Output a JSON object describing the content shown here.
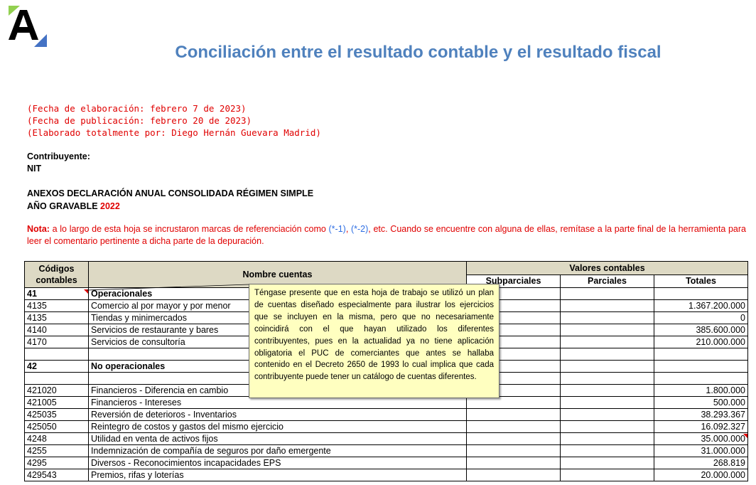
{
  "header": {
    "title": "Conciliación entre el resultado contable y el resultado fiscal"
  },
  "info": {
    "dates": [
      "(Fecha de elaboración: febrero 7 de 2023)",
      "(Fecha de publicación: febrero 20 de 2023)",
      "(Elaborado totalmente por: Diego Hernán Guevara Madrid)"
    ],
    "contribuyente": "Contribuyente:",
    "nit": "NIT",
    "anexos": "ANEXOS DECLARACIÓN ANUAL CONSOLIDADA RÉGIMEN SIMPLE",
    "ano_label": "AÑO GRAVABLE",
    "ano_value": "2022"
  },
  "nota": {
    "label": "Nota:",
    "text1": " a lo largo de esta hoja se incrustaron marcas de referenciación como ",
    "ref1": "(*-1)",
    "sep": ", ",
    "ref2": "(*-2)",
    "text2": ", etc. Cuando se encuentre con alguna de ellas, remítase a la parte final de la herramienta para leer el comentario pertinente a dicha parte de la depuración."
  },
  "table": {
    "col_codigos": "Códigos contables",
    "col_nombre": "Nombre cuentas",
    "col_valores": "Valores contables",
    "col_subparciales": "Subparciales",
    "col_parciales": "Parciales",
    "col_totales": "Totales",
    "rows": [
      {
        "code": "41",
        "name": "Operacionales",
        "total": "",
        "bold": true
      },
      {
        "code": "4135",
        "name": "Comercio al por mayor y por menor",
        "total": "1.367.200.000"
      },
      {
        "code": "4135",
        "name": "Tiendas y minimercados",
        "total": "0"
      },
      {
        "code": "4140",
        "name": "Servicios de restaurante y bares",
        "total": "385.600.000"
      },
      {
        "code": "4170",
        "name": "Servicios de consultoría",
        "total": "210.000.000"
      },
      {
        "code": "",
        "name": "",
        "total": ""
      },
      {
        "code": "42",
        "name": "No operacionales",
        "total": "",
        "bold": true
      },
      {
        "code": "",
        "name": "",
        "total": ""
      },
      {
        "code": "421020",
        "name": "Financieros - Diferencia en cambio",
        "total": "1.800.000"
      },
      {
        "code": "421005",
        "name": "Financieros - Intereses",
        "total": "500.000"
      },
      {
        "code": "425035",
        "name": "Reversión de deterioros - Inventarios",
        "total": "38.293.367"
      },
      {
        "code": "425050",
        "name": "Reintegro de costos y gastos del mismo ejercicio",
        "total": "16.092.327"
      },
      {
        "code": "4248",
        "name": "Utilidad en venta de activos fijos",
        "total": "35.000.000"
      },
      {
        "code": "4255",
        "name": "Indemnización de compañía de seguros por daño emergente",
        "total": "31.000.000"
      },
      {
        "code": "4295",
        "name": "Diversos - Reconocimientos incapacidades EPS",
        "total": "268.819"
      },
      {
        "code": "429543",
        "name": "Premios, rifas y loterías",
        "total": "20.000.000"
      }
    ]
  },
  "comment": {
    "text": "Téngase presente que en esta hoja de trabajo se utilizó un plan de cuentas diseñado especialmente para ilustrar los ejercicios que se incluyen en la misma, pero que no necesariamente coincidirá con el que hayan utilizado los diferentes contribuyentes, pues en la actualidad ya no tiene aplicación obligatoria el PUC de comerciantes que antes se hallaba contenido en el Decreto 2650 de 1993 lo cual implica que cada contribuyente puede tener un catálogo de cuentas diferentes."
  },
  "colors": {
    "title": "#4f81bd",
    "red": "#e00000",
    "ref_blue": "#2f6fe4",
    "header_fill": "#ddd9c4",
    "comment_fill": "#ffffc0"
  }
}
